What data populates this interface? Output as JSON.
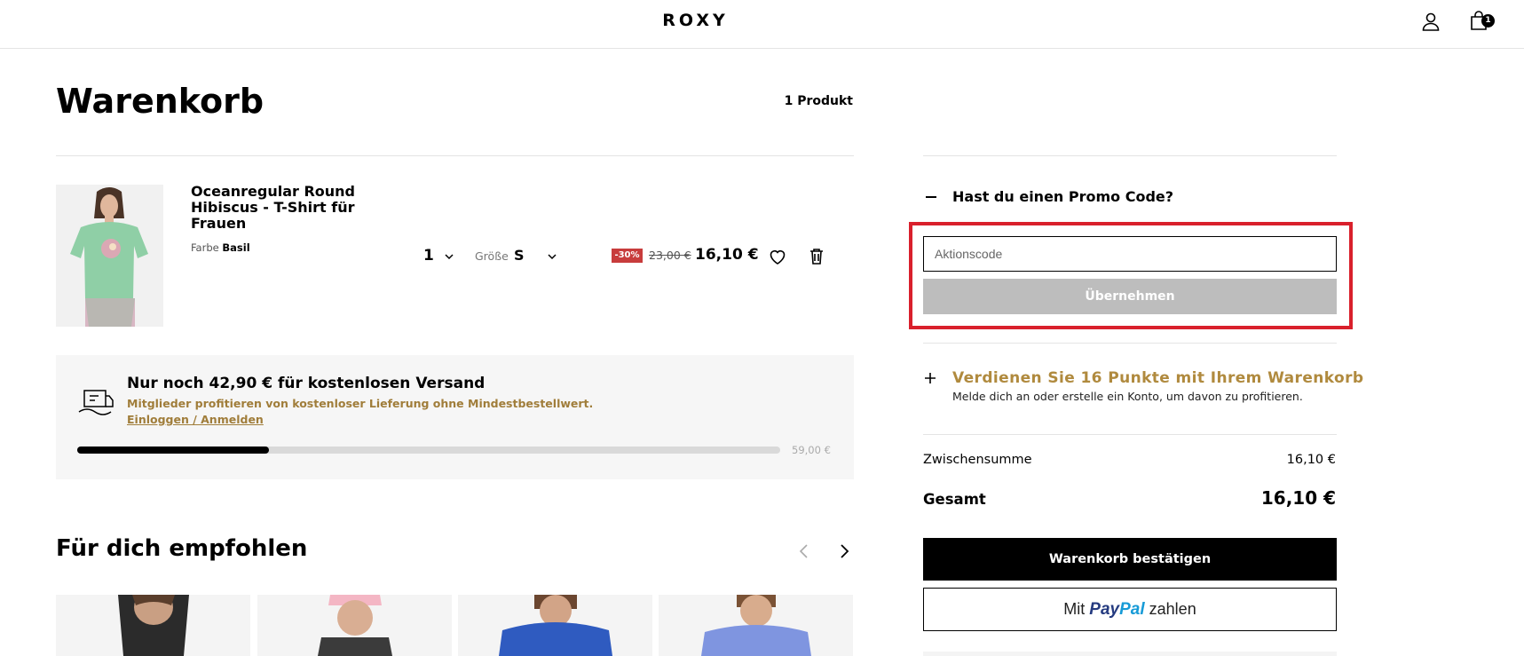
{
  "header": {
    "logo": "ROXY",
    "account_icon": "user-icon",
    "cart_icon": "shopping-bag-icon",
    "cart_count": "1"
  },
  "cart": {
    "title": "Warenkorb",
    "product_count": "1 Produkt",
    "item": {
      "name": "Oceanregular Round Hibiscus - T-Shirt für Frauen",
      "color_label": "Farbe",
      "color_value": "Basil",
      "quantity": "1",
      "size_label": "Größe",
      "size_value": "S",
      "discount": "-30%",
      "old_price": "23,00 €",
      "price": "16,10 €",
      "wishlist_icon": "heart-icon",
      "delete_icon": "trash-icon"
    }
  },
  "shipping": {
    "title": "Nur noch 42,90 € für kostenlosen Versand",
    "subtitle": "Mitglieder profitieren von kostenloser Lieferung ohne Mindestbestellwert.",
    "link": "Einloggen / Anmelden",
    "goal": "59,00 €",
    "progress": 0.273,
    "icon": "delivery-truck-icon"
  },
  "recommendations": {
    "title": "Für dich empfohlen",
    "card_count_visible": 4
  },
  "promo": {
    "toggle_label": "Hast du einen Promo Code?",
    "input_placeholder": "Aktionscode",
    "input_value": "",
    "apply_label": "Übernehmen"
  },
  "points": {
    "title": "Verdienen Sie 16 Punkte mit Ihrem Warenkorb",
    "subtitle": "Melde dich an oder erstelle ein Konto, um davon zu profitieren."
  },
  "summary": {
    "subtotal_label": "Zwischensumme",
    "subtotal_value": "16,10 €",
    "total_label": "Gesamt",
    "total_value": "16,10 €",
    "checkout_label": "Warenkorb bestätigen",
    "paypal_prefix": "Mit",
    "paypal_brand_a": "Pay",
    "paypal_brand_b": "Pal",
    "paypal_suffix": "zahlen"
  },
  "colors": {
    "accent_gold": "#b08a3e",
    "discount_red": "#c83c3c",
    "highlight_red": "#d9202c",
    "disabled_gray": "#bdbdbd"
  }
}
